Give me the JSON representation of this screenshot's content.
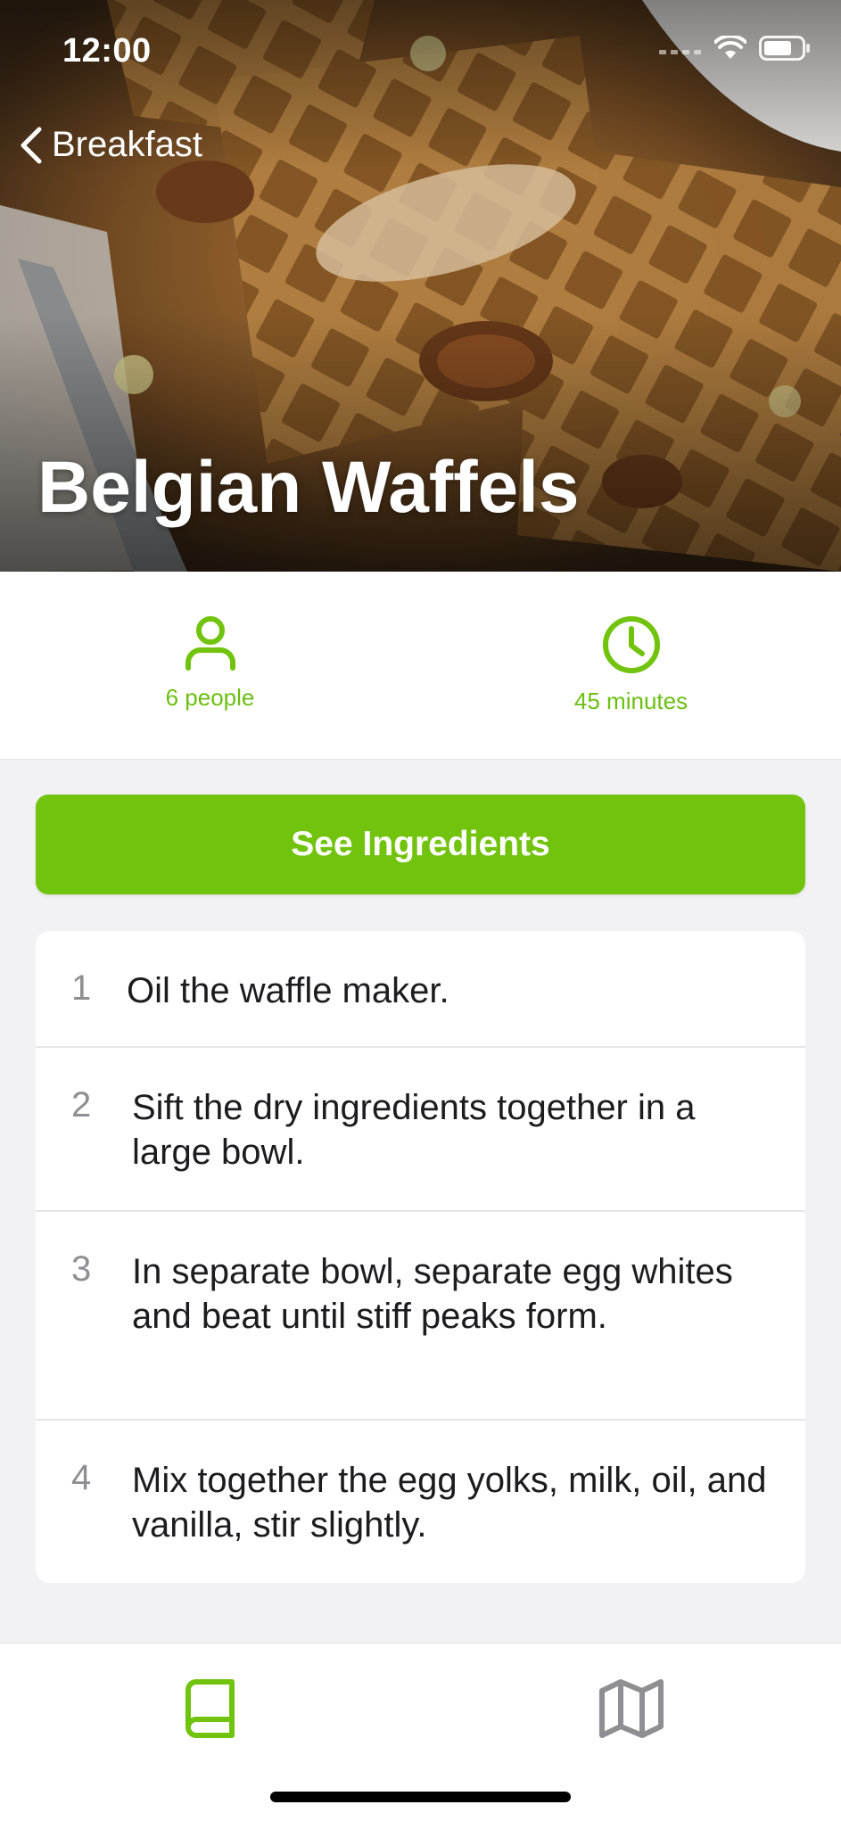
{
  "status_bar": {
    "time": "12:00"
  },
  "nav": {
    "back_label": "Breakfast"
  },
  "recipe": {
    "title": "Belgian Waffels",
    "servings": "6 people",
    "duration": "45 minutes"
  },
  "actions": {
    "ingredients_button": "See Ingredients"
  },
  "steps": [
    {
      "number": "1",
      "text": "Oil the waffle maker."
    },
    {
      "number": "2",
      "text": "Sift the dry ingredients together in a large bowl."
    },
    {
      "number": "3",
      "text": "In separate bowl, separate egg whites and beat until stiff peaks form."
    },
    {
      "number": "4",
      "text": "Mix together the egg yolks, milk, oil, and vanilla, stir slightly."
    }
  ],
  "tab_bar": {
    "items": [
      {
        "icon": "book-icon",
        "active": true
      },
      {
        "icon": "map-icon",
        "active": false
      }
    ]
  },
  "colors": {
    "accent": "#71c30e",
    "accent_text": "#6bbf12",
    "inactive_icon": "#8e8e93",
    "background": "#f2f2f4"
  }
}
